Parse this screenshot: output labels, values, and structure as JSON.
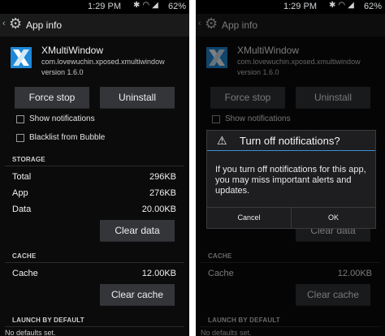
{
  "status_bar": {
    "time": "1:29",
    "time_suffix": "PM",
    "battery": "62%",
    "icons": [
      "bluetooth-icon",
      "wifi-icon",
      "signal-icon"
    ]
  },
  "action_bar": {
    "title": "App info",
    "icon": "gear-icon",
    "back_icon": "back-chevron-icon"
  },
  "app": {
    "name": "XMultiWindow",
    "package": "com.lovewuchin.xposed.xmultiwindow",
    "version": "version 1.6.0",
    "logo_icon": "xmultiwindow-logo-icon"
  },
  "buttons": {
    "force_stop": "Force stop",
    "uninstall": "Uninstall",
    "clear_data": "Clear data",
    "clear_cache": "Clear cache"
  },
  "checkboxes": [
    {
      "label": "Show notifications",
      "checked": false
    },
    {
      "label": "Blacklist from Bubble",
      "checked": false
    }
  ],
  "storage": {
    "header": "STORAGE",
    "rows": [
      {
        "label": "Total",
        "value": "296KB"
      },
      {
        "label": "App",
        "value": "276KB"
      },
      {
        "label": "Data",
        "value": "20.00KB"
      }
    ]
  },
  "cache": {
    "header": "CACHE",
    "label": "Cache",
    "value": "12.00KB"
  },
  "launch": {
    "header": "LAUNCH BY DEFAULT",
    "trailing_text": "No defaults set."
  },
  "dialog": {
    "title": "Turn off notifications?",
    "icon": "warning-icon",
    "message": "If you turn off notifications for this app, you may miss important alerts and updates.",
    "cancel": "Cancel",
    "ok": "OK"
  },
  "colors": {
    "background": "#0b0b0b",
    "button": "#333539",
    "accent": "#3d8fd6",
    "logo_blue": "#1e88d8"
  }
}
